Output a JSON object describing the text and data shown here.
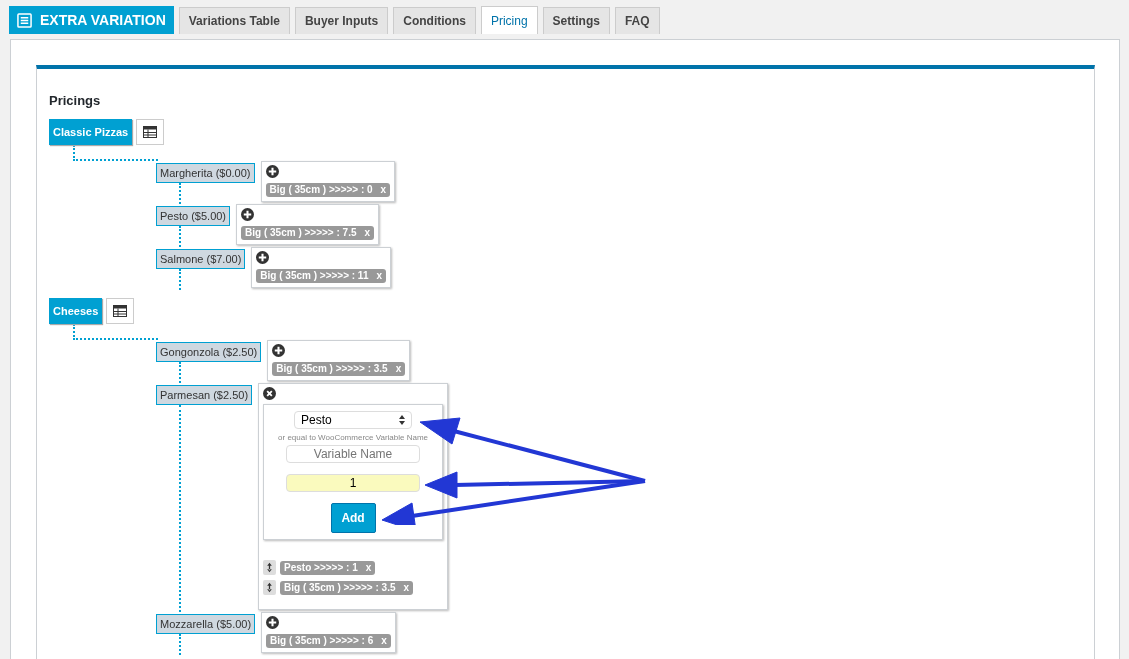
{
  "brand": {
    "title": "EXTRA VARIATION"
  },
  "tabs": [
    {
      "label": "Variations Table",
      "selected": false
    },
    {
      "label": "Buyer Inputs",
      "selected": false
    },
    {
      "label": "Conditions",
      "selected": false
    },
    {
      "label": "Pricing",
      "selected": true
    },
    {
      "label": "Settings",
      "selected": false
    },
    {
      "label": "FAQ",
      "selected": false
    }
  ],
  "heading": "Pricings",
  "groups": [
    {
      "label": "Classic Pizzas",
      "items": [
        {
          "label": "Margherita ($0.00)",
          "expanded": false,
          "tags": [
            {
              "text": "Big ( 35cm ) >>>>> : 0",
              "remove": "x"
            }
          ]
        },
        {
          "label": "Pesto ($5.00)",
          "expanded": false,
          "tags": [
            {
              "text": "Big ( 35cm ) >>>>> : 7.5",
              "remove": "x"
            }
          ]
        },
        {
          "label": "Salmone ($7.00)",
          "expanded": false,
          "tags": [
            {
              "text": "Big ( 35cm ) >>>>> : 11",
              "remove": "x"
            }
          ]
        }
      ]
    },
    {
      "label": "Cheeses",
      "items": [
        {
          "label": "Gongonzola ($2.50)",
          "expanded": false,
          "tags": [
            {
              "text": "Big ( 35cm ) >>>>> : 3.5",
              "remove": "x"
            }
          ]
        },
        {
          "label": "Parmesan ($2.50)",
          "expanded": true,
          "form": {
            "select": "Pesto",
            "hint": "or equal to WooCommerce Variable Name",
            "name_placeholder": "Variable Name",
            "value": "1",
            "button": "Add"
          },
          "tags": [
            {
              "text": "Pesto >>>>> : 1",
              "remove": "x"
            },
            {
              "text": "Big ( 35cm ) >>>>> : 3.5",
              "remove": "x"
            }
          ]
        },
        {
          "label": "Mozzarella ($5.00)",
          "expanded": false,
          "tags": [
            {
              "text": "Big ( 35cm ) >>>>> : 6",
              "remove": "x"
            }
          ]
        }
      ]
    }
  ]
}
